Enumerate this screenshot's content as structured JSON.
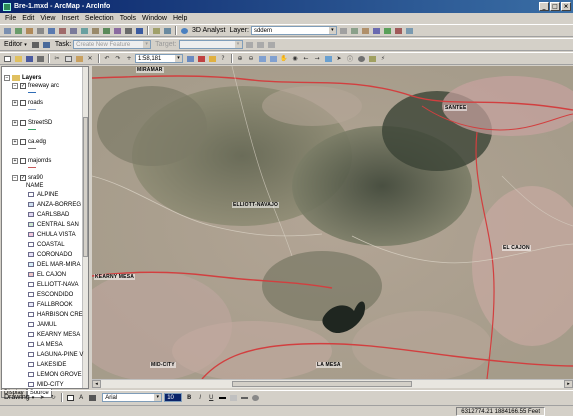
{
  "window": {
    "title": "Bre-1.mxd - ArcMap - ArcInfo",
    "minimize": "_",
    "maximize": "□",
    "close": "×"
  },
  "menu": [
    "File",
    "Edit",
    "View",
    "Insert",
    "Selection",
    "Tools",
    "Window",
    "Help"
  ],
  "toolbar": {
    "layer_label": "Layer:",
    "layer_value": "sddem",
    "analyst_label": "3D Analyst",
    "editor_label": "Editor",
    "task_label": "Task:",
    "task_value": "Create New Feature",
    "target_label": "Target:",
    "zoom_value": "1:58,181"
  },
  "toc": {
    "root": "Layers",
    "layers": [
      {
        "name": "freeway arc",
        "checked": true,
        "color": "#2f6db6"
      },
      {
        "name": "roads",
        "checked": false,
        "color": "#8aa3c0"
      },
      {
        "name": "StreetSD",
        "checked": false,
        "color": "#3aa36a"
      },
      {
        "name": "ca.edg",
        "checked": false,
        "color": "#7a7a7a"
      },
      {
        "name": "majorrds",
        "checked": false,
        "color": "#c75a5a"
      },
      {
        "name": "sra90",
        "checked": true,
        "color": "#6a6a8a"
      }
    ],
    "field_header": "NAME",
    "names": [
      "ALPINE",
      "ANZA-BORREG",
      "CARLSBAD",
      "CENTRAL SAN",
      "CHULA VISTA",
      "COASTAL",
      "CORONADO",
      "DEL MAR-MIRA",
      "EL CAJON",
      "ELLIOTT-NAVA",
      "ESCONDIDO",
      "FALLBROOK",
      "HARBISON CRE",
      "JAMUL",
      "KEARNY MESA",
      "LA MESA",
      "LAGUNA-PINE V",
      "LAKESIDE",
      "LEMON GROVE",
      "MID-CITY"
    ],
    "swatch_colors": [
      "#ffffff",
      "#cfe0f0",
      "#e0d6f0",
      "#cfe8d0",
      "#f3c9dc",
      "#ffffff",
      "#e6e0f6",
      "#d7eef6",
      "#f0c8c8",
      "#ffffff",
      "#ffffff",
      "#e9e9f9",
      "#ffffff",
      "#ffffff",
      "#ffffff",
      "#ffffff",
      "#ffffff",
      "#ffffff",
      "#ffffff",
      "#ffffff"
    ],
    "tabs": [
      "Display",
      "Source"
    ]
  },
  "map": {
    "labels": [
      "MIRAMAR",
      "SANTEE",
      "ELLIOTT-NAVAJO",
      "EL CAJON",
      "KEARNY MESA",
      "MID-CITY",
      "LA MESA"
    ]
  },
  "drawing": {
    "label": "Drawing",
    "font": "Arial",
    "font_size": "10",
    "bold": "B",
    "italic": "I",
    "underline": "U"
  },
  "status": {
    "coords": "6312774.21  1884166.55 Feet"
  }
}
